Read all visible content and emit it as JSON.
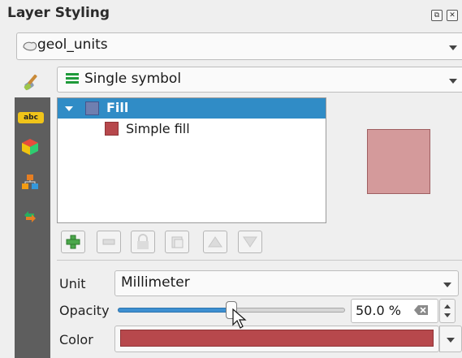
{
  "panel": {
    "title": "Layer Styling",
    "float_icon": "float-icon",
    "close_icon": "close-icon"
  },
  "layer": {
    "name": "geol_units",
    "icon": "polygon-layer-icon"
  },
  "renderer": {
    "label": "Single symbol",
    "icon": "single-symbol-icon"
  },
  "tool_strip": {
    "items": [
      {
        "name": "symbology-icon"
      },
      {
        "name": "labels-icon",
        "text": "abc"
      },
      {
        "name": "3d-view-icon"
      },
      {
        "name": "diagrams-icon"
      },
      {
        "name": "history-icon"
      }
    ]
  },
  "symbol_tree": {
    "root": {
      "label": "Fill",
      "expanded": true,
      "selected": true
    },
    "children": [
      {
        "label": "Simple fill",
        "color": "#b7484c"
      }
    ]
  },
  "toolbar": {
    "buttons": [
      {
        "name": "add-symbol-layer-button",
        "icon": "plus-icon",
        "enabled": true
      },
      {
        "name": "remove-symbol-layer-button",
        "icon": "minus-icon",
        "enabled": false
      },
      {
        "name": "lock-color-button",
        "icon": "lock-icon",
        "enabled": false
      },
      {
        "name": "duplicate-layer-button",
        "icon": "duplicate-icon",
        "enabled": false
      },
      {
        "name": "move-up-button",
        "icon": "up-arrow-icon",
        "enabled": false
      },
      {
        "name": "move-down-button",
        "icon": "down-arrow-icon",
        "enabled": false
      }
    ]
  },
  "properties": {
    "unit_label": "Unit",
    "unit_value": "Millimeter",
    "opacity_label": "Opacity",
    "opacity_value": "50.0 %",
    "opacity_fraction": 0.5,
    "color_label": "Color",
    "color_value": "#b7484c"
  },
  "colors": {
    "selection": "#308cc6",
    "fill_preview": "#d49a9b",
    "symbol_color": "#b7484c",
    "slider_fill": "#3d8fd1",
    "tool_strip_bg": "#5e5e5e"
  }
}
